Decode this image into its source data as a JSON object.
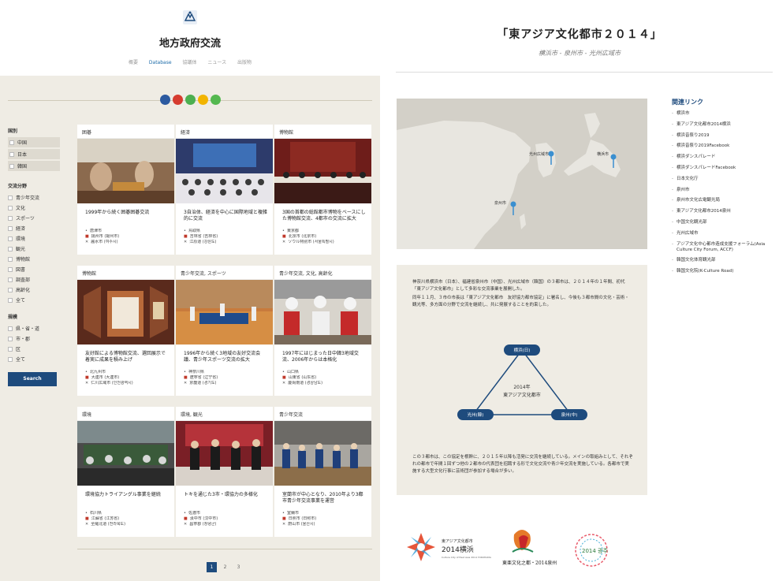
{
  "left": {
    "site_title": "地方政府交流",
    "nav": [
      {
        "label": "概要",
        "active": false
      },
      {
        "label": "Database",
        "active": true
      },
      {
        "label": "協議体",
        "active": false
      },
      {
        "label": "ニュース",
        "active": false
      },
      {
        "label": "出版物",
        "active": false
      }
    ],
    "share_colors": [
      "#2c5aa0",
      "#d63c2f",
      "#4caf50",
      "#f2b400",
      "#54b84f"
    ],
    "filters": {
      "region_heading": "国別",
      "regions": [
        "中国",
        "日本",
        "韓国"
      ],
      "field_heading": "交流分野",
      "fields": [
        "青少年交流",
        "文化",
        "スポーツ",
        "経済",
        "環境",
        "観光",
        "博物館",
        "図書",
        "調査部",
        "高齢化",
        "全て"
      ],
      "scale_heading": "規模",
      "scales": [
        "県・省・道",
        "市・郡",
        "区",
        "全て"
      ],
      "search_label": "Search"
    },
    "cards": [
      {
        "tag": "囲碁",
        "title": "1999年から続く囲碁囲碁交流",
        "m1": "唐津市",
        "m2": "揚州市 (揚州市)",
        "m3": "麗水市 (여수시)"
      },
      {
        "tag": "経済",
        "title": "3自治体、経済を中心に国際地域と複雑的に交流",
        "m1": "鳥取県",
        "m2": "吉林省 (吉林省)",
        "m3": "江原道 (강원도)"
      },
      {
        "tag": "博物館",
        "title": "3国の首都の総館都市博物をベースにした博物館交流、4都市の交流に拡大",
        "m1": "東京都",
        "m2": "北京市 (北京市)",
        "m3": "ソウル特別市 (서울특별시)"
      },
      {
        "tag": "博物館",
        "title": "友好館による博物館交流、選回展示で着実に成果を積み上げ",
        "m1": "北九州市",
        "m2": "大連市 (大連市)",
        "m3": "仁川広域市 (인천광역시)"
      },
      {
        "tag": "青少年交流, スポーツ",
        "title": "1996年から続く3地域の友好交流会議、青少年スポーツ交流の拡大",
        "m1": "神奈川県",
        "m2": "遼寧省 (辽宁省)",
        "m3": "京畿道 (경기도)"
      },
      {
        "tag": "青少年交流, 文化, 高齢化",
        "title": "1997年にはじまった日中韓3地域交流、2006年からは本格化",
        "m1": "山口県",
        "m2": "山東省 (山东省)",
        "m3": "慶尚南道 (경상남도)"
      },
      {
        "tag": "環境",
        "title": "環境協力トライアングル事業を継続",
        "m1": "石川県",
        "m2": "江蘇省 (江苏省)",
        "m3": "全羅北道 (전라북도)"
      },
      {
        "tag": "環境, 観光",
        "title": "トキを通じた3市・環協力の多様化",
        "m1": "佐渡市",
        "m2": "漢中市 (汉中市)",
        "m3": "昌寧郡 (창녕군)"
      },
      {
        "tag": "青少年交流",
        "title": "室蘭市が中心となり、2010年より3都市青少年交流事業を運営",
        "m1": "室蘭市",
        "m2": "日照市 (日照市)",
        "m3": "蔚山市 (울산시)"
      }
    ],
    "pages": [
      "1",
      "2",
      "3"
    ]
  },
  "right": {
    "title": "「東アジア文化都市２０１４」",
    "subtitle": "横浜市 - 泉州市 - 光州広域市",
    "map_labels": [
      "光州広域市",
      "横浜市",
      "泉州市"
    ],
    "links_heading": "関連リンク",
    "links": [
      "横浜市",
      "東アジア文化都市2014横浜",
      "横浜音祭り2019",
      "横浜音祭り2019Facebook",
      "横浜ダンスパレード",
      "横浜ダンスパレードFacebook",
      "日本文化庁",
      "泉州市",
      "泉州市文化広電観光局",
      "東アジア文化都市2014泉州",
      "中国文化観光部",
      "光州広域市",
      "アジア文化中心都市造成支援フォーラム(Asia Culture City Forum, ACCF)",
      "韓国文化体育観光部",
      "韓国文化院(K-Culture Road)"
    ],
    "info_p1": "神奈川県横浜市（日本）、福建省泉州市（中国）、光州広域市（韓国）の３都市は、２０１４年の１年間、初代「東アジア文化都市」として多彩な交流事業を展開した。",
    "info_p2": "同年１１月、３市の市長は「東アジア文化都市　友好協力都市協定」に署名し、今後も３都市間の文化・芸術・観光等、多方面の分野で交流を継続し、共に発展することを約束した。",
    "tri_center1": "2014年",
    "tri_center2": "東アジア文化都市",
    "tri_top": "横浜(日)",
    "tri_left": "光州(韓)",
    "tri_right": "泉州(中)",
    "info_p3": "この３都市は、この協定を根幹に、２０１５年以降も活発に交流を継続している。メインの取組みとして、それぞれの都市で年間１回ずつ他の２都市の代表団を招聘する形で文化交流や青少年交流を実施している。各都市で実施する大型文化行事に芸術団が参加する場合が多い。",
    "logo1_line1": "東アジア文化都市",
    "logo1_line2": "2014横浜",
    "logo1_line3": "Culture City of East Asia 2014 YOKOHAMA",
    "logo2_text": "東亜文化之都・2014泉州",
    "logo3_text": "2014 광주"
  }
}
